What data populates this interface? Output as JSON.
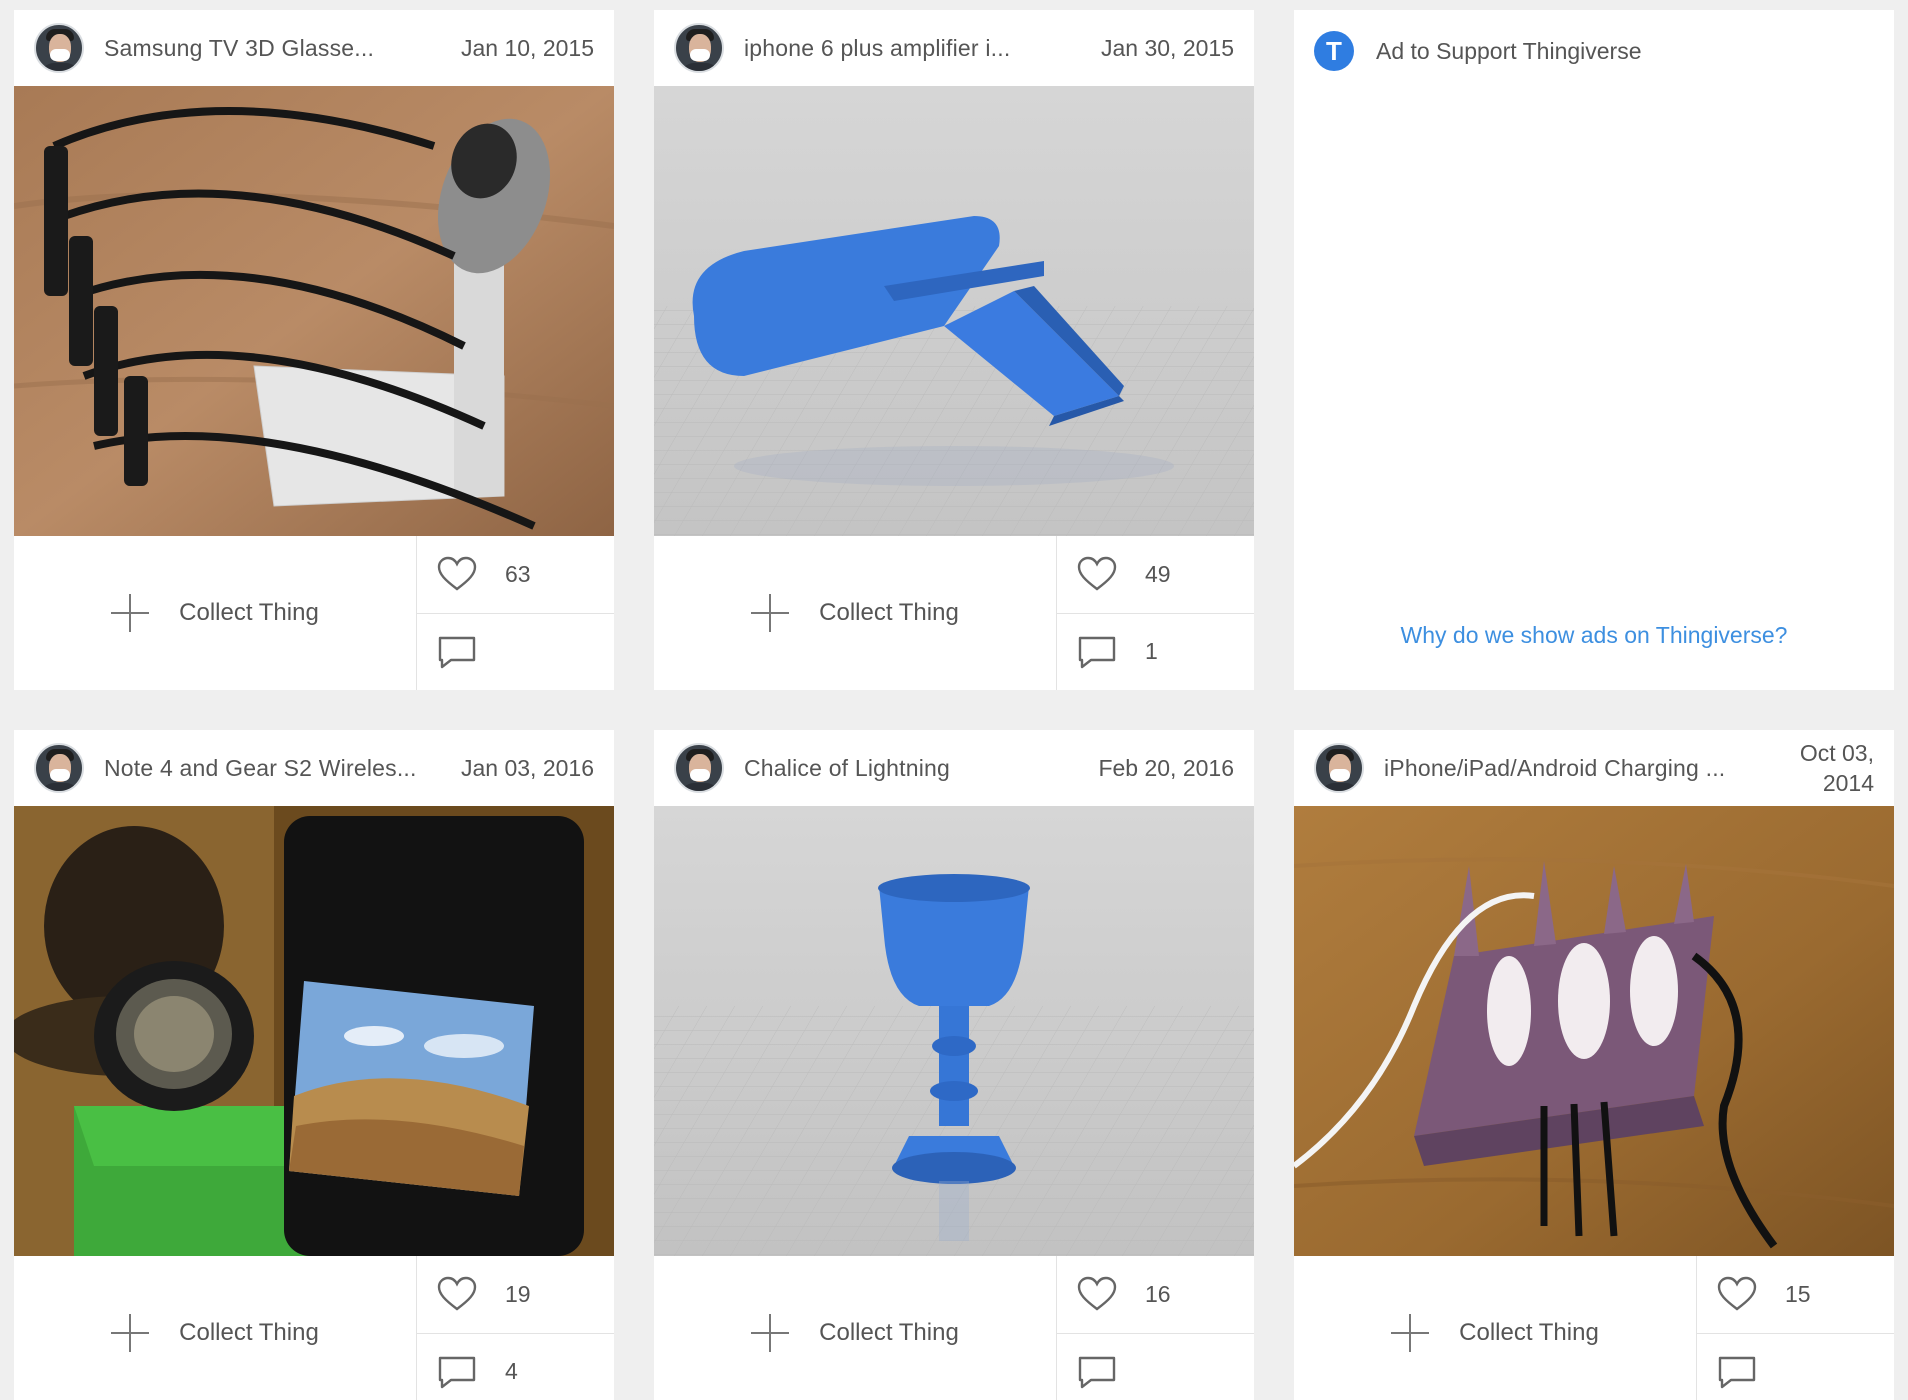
{
  "cards": [
    {
      "title": "Samsung TV 3D Glasse...",
      "date": "Jan 10, 2015",
      "collect_label": "Collect Thing",
      "likes": "63",
      "comments": ""
    },
    {
      "title": "iphone 6 plus amplifier i...",
      "date": "Jan 30, 2015",
      "collect_label": "Collect Thing",
      "likes": "49",
      "comments": "1"
    },
    {
      "title": "Note 4 and Gear S2 Wireles...",
      "date": "Jan 03, 2016",
      "collect_label": "Collect Thing",
      "likes": "19",
      "comments": "4"
    },
    {
      "title": "Chalice of Lightning",
      "date": "Feb 20, 2016",
      "collect_label": "Collect Thing",
      "likes": "16",
      "comments": ""
    },
    {
      "title": "iPhone/iPad/Android Charging ...",
      "date": "Oct 03, 2014",
      "collect_label": "Collect Thing",
      "likes": "15",
      "comments": ""
    }
  ],
  "ad": {
    "logo_letter": "T",
    "title": "Ad to Support Thingiverse",
    "link": "Why do we show ads on Thingiverse?"
  },
  "colors": {
    "page_bg": "#efefef",
    "card_bg": "#ffffff",
    "text": "#555555",
    "link": "#3d8fe0",
    "brand": "#2f7de1"
  }
}
